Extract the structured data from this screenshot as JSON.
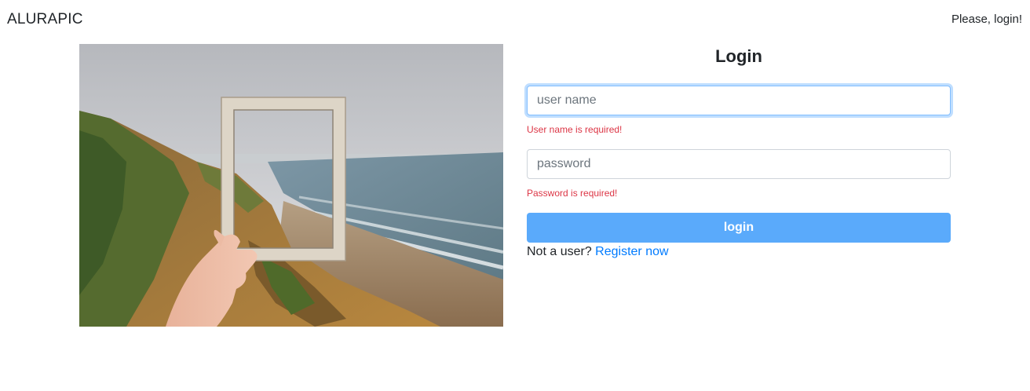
{
  "nav": {
    "brand": "ALURAPIC",
    "status": "Please, login!"
  },
  "hero_image": {
    "alt": "hand holding a picture frame in front of a seaside cliff"
  },
  "login_form": {
    "title": "Login",
    "username": {
      "placeholder": "user name",
      "value": "",
      "error": "User name is required!"
    },
    "password": {
      "placeholder": "password",
      "value": "",
      "error": "Password is required!"
    },
    "submit_label": "login",
    "register_prompt": "Not a user?",
    "register_link": "Register now"
  },
  "colors": {
    "button_bg": "#5aaafb",
    "error": "#dc3545",
    "link": "#007bff",
    "focus_border": "#80bdff"
  }
}
